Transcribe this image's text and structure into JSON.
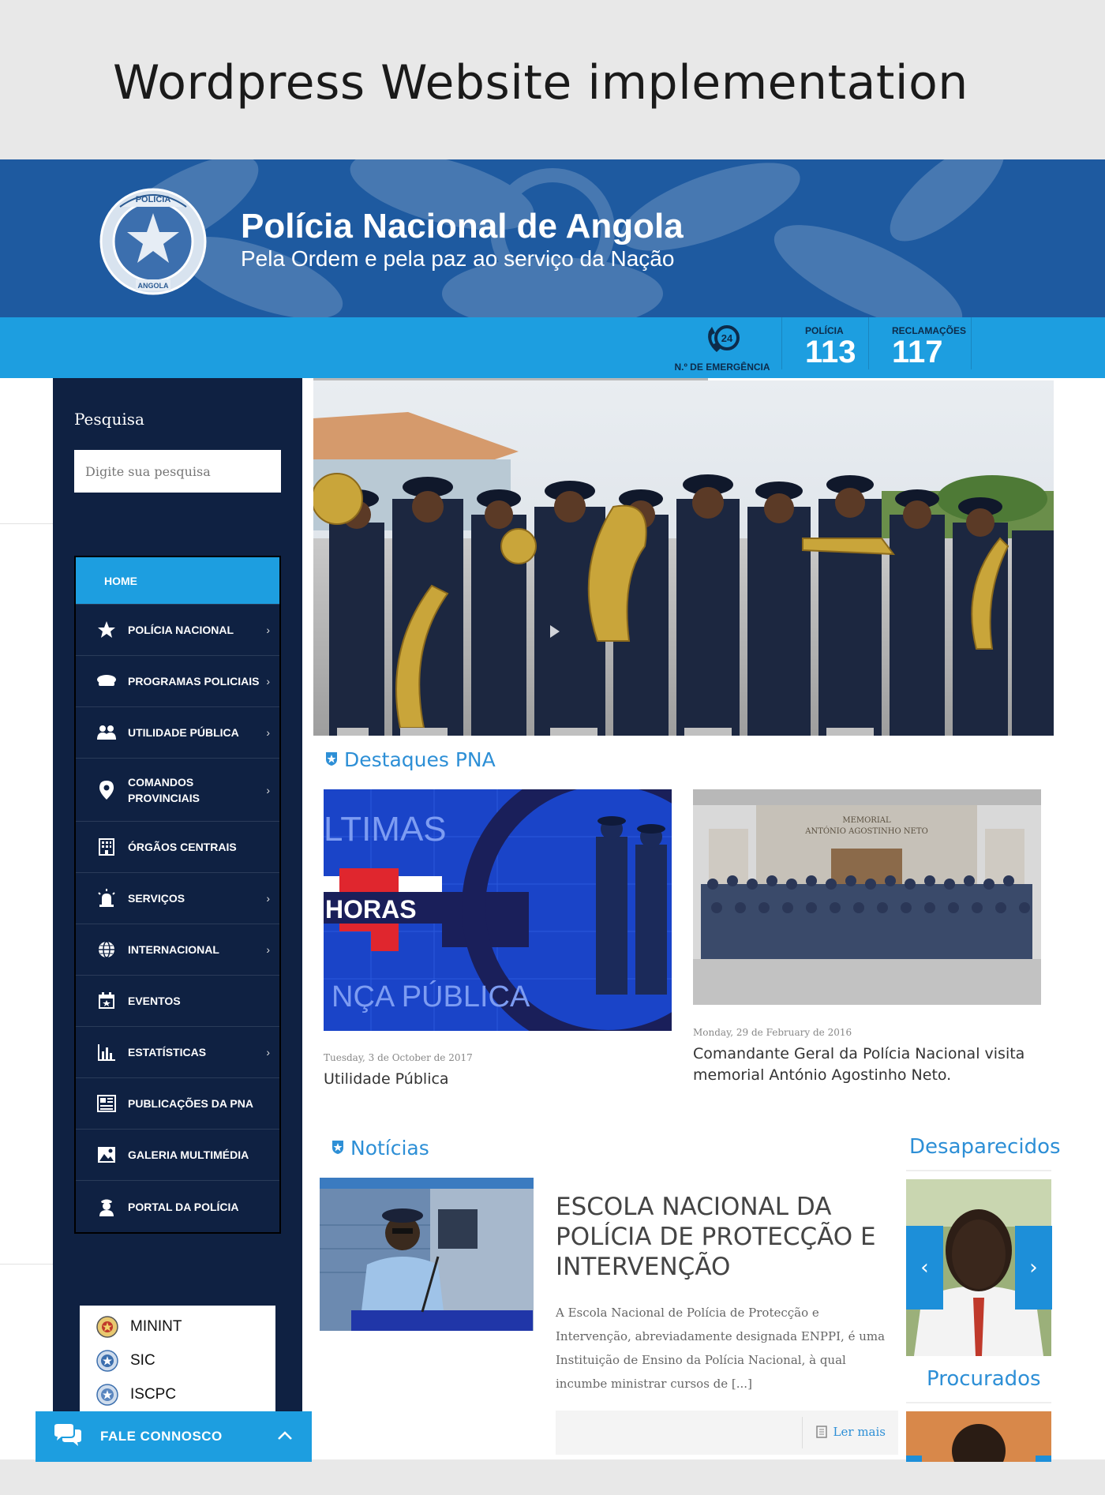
{
  "showcase": {
    "title": "Wordpress Website implementation"
  },
  "header": {
    "site_title": "Polícia Nacional de Angola",
    "tagline": "Pela Ordem e pela paz ao serviço da Nação",
    "logo_text_top": "POLÍCIA",
    "logo_text_bottom": "ANGOLA"
  },
  "emergency": {
    "phone_badge": "24",
    "phone_label": "N.º DE EMERGÊNCIA",
    "numbers": [
      {
        "label": "POLÍCIA",
        "value": "113"
      },
      {
        "label": "RECLAMAÇÕES",
        "value": "117"
      }
    ]
  },
  "sidebar": {
    "search_title": "Pesquisa",
    "search_placeholder": "Digite sua pesquisa",
    "menu": [
      {
        "label": "HOME",
        "icon": "none",
        "active": true
      },
      {
        "label": "POLÍCIA NACIONAL",
        "icon": "star-icon",
        "chevron": true
      },
      {
        "label": "PROGRAMAS POLICIAIS",
        "icon": "police-cap-icon",
        "chevron": true
      },
      {
        "label": "UTILIDADE PÚBLICA",
        "icon": "users-icon",
        "chevron": true
      },
      {
        "label": "COMANDOS PROVINCIAIS",
        "icon": "map-pin-icon",
        "chevron": true
      },
      {
        "label": "ÓRGÃOS CENTRAIS",
        "icon": "building-icon",
        "chevron": false
      },
      {
        "label": "SERVIÇOS",
        "icon": "siren-icon",
        "chevron": true
      },
      {
        "label": "INTERNACIONAL",
        "icon": "globe-icon",
        "chevron": true
      },
      {
        "label": "EVENTOS",
        "icon": "calendar-icon",
        "chevron": false
      },
      {
        "label": "ESTATÍSTICAS",
        "icon": "bar-chart-icon",
        "chevron": true
      },
      {
        "label": "PUBLICAÇÕES DA PNA",
        "icon": "newspaper-icon",
        "chevron": false
      },
      {
        "label": "GALERIA MULTIMÉDIA",
        "icon": "image-icon",
        "chevron": false
      },
      {
        "label": "PORTAL DA POLÍCIA",
        "icon": "officer-icon",
        "chevron": false
      }
    ],
    "links": [
      "MININT",
      "SIC",
      "ISCPC"
    ],
    "chat_label": "FALE CONNOSCO"
  },
  "main": {
    "highlights_title": "Destaques PNA",
    "highlights": [
      {
        "date": "Tuesday, 3 de October de 2017",
        "title": "Utilidade Pública",
        "image_text_1": "LTIMAS",
        "image_text_2": "HORAS",
        "image_text_3": "NÇA PÚBLICA"
      },
      {
        "date": "Monday, 29 de February de 2016",
        "title": "Comandante Geral da Polícia Nacional visita memorial António Agostinho Neto.",
        "image_text_1": "MEMORIAL",
        "image_text_2": "ANTÓNIO AGOSTINHO NETO"
      }
    ],
    "news_title": "Notícias",
    "news": {
      "headline": "ESCOLA NACIONAL DA POLÍCIA DE PROTECÇÃO E INTERVENÇÃO",
      "excerpt": "A Escola Nacional de Polícia de Protecção e Intervenção, abreviadamente designada ENPPI, é uma Instituição de Ensino da Polícia Nacional, à qual incumbe ministrar cursos de [...]",
      "read_more": "Ler mais"
    },
    "missing_title": "Desaparecidos",
    "wanted_title": "Procurados"
  },
  "colors": {
    "header_blue": "#1e5aa0",
    "accent_blue": "#1d9ee0",
    "sidebar_navy": "#0f2142",
    "link_blue": "#2d8fd6"
  }
}
